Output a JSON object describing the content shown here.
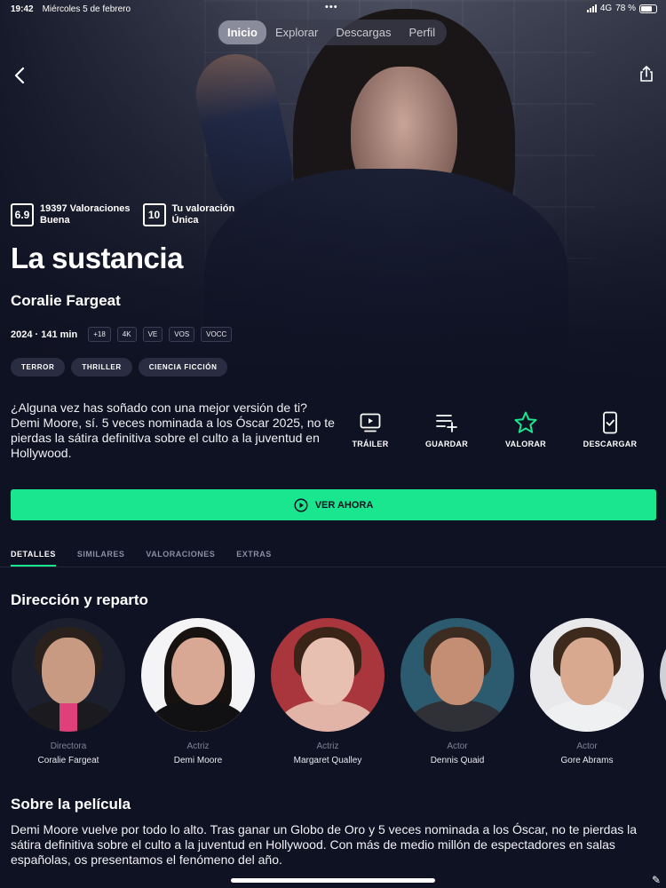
{
  "status_bar": {
    "time": "19:42",
    "date": "Miércoles 5 de febrero",
    "network": "4G",
    "battery_percent": "78 %",
    "battery_level": 0.78
  },
  "top_nav": {
    "tabs": [
      {
        "label": "Inicio",
        "active": true
      },
      {
        "label": "Explorar",
        "active": false
      },
      {
        "label": "Descargas",
        "active": false
      },
      {
        "label": "Perfil",
        "active": false
      }
    ]
  },
  "movie": {
    "title": "La sustancia",
    "director": "Coralie Fargeat",
    "year_duration": "2024 · 141 min",
    "badges": [
      "+18",
      "4K",
      "VE",
      "VOS",
      "VOCC"
    ],
    "genres": [
      "TERROR",
      "THRILLER",
      "CIENCIA FICCIÓN"
    ],
    "synopsis": "¿Alguna vez has soñado con una mejor versión de ti? Demi Moore, sí. 5 veces nominada a los Óscar 2025, no te pierdas la sátira definitiva sobre el culto a la juventud en Hollywood."
  },
  "ratings": {
    "score": "6.9",
    "count_label": "19397 Valoraciones",
    "quality": "Buena",
    "user_score": "10",
    "user_label": "Tu valoración",
    "user_quality": "Única"
  },
  "actions": {
    "trailer": "TRÁILER",
    "save": "GUARDAR",
    "rate": "VALORAR",
    "download": "DESCARGAR"
  },
  "watch_button": {
    "label": "VER AHORA"
  },
  "detail_tabs": [
    {
      "label": "DETALLES",
      "active": true
    },
    {
      "label": "SIMILARES",
      "active": false
    },
    {
      "label": "VALORACIONES",
      "active": false
    },
    {
      "label": "EXTRAS",
      "active": false
    }
  ],
  "cast_section": {
    "title": "Dirección y reparto",
    "people": [
      {
        "role": "Directora",
        "name": "Coralie Fargeat"
      },
      {
        "role": "Actriz",
        "name": "Demi Moore"
      },
      {
        "role": "Actriz",
        "name": "Margaret Qualley"
      },
      {
        "role": "Actor",
        "name": "Dennis Quaid"
      },
      {
        "role": "Actor",
        "name": "Gore Abrams"
      }
    ]
  },
  "about_section": {
    "title": "Sobre la película",
    "text": "Demi Moore vuelve por todo lo alto. Tras ganar un Globo de Oro y 5 veces nominada a los Óscar, no te pierdas la sátira definitiva sobre el culto a la juventud en Hollywood. Con más de medio millón de espectadores en salas españolas, os presentamos el fenómeno del año."
  },
  "colors": {
    "background": "#0f1222",
    "accent": "#1ae68f",
    "chip": "#2a2d42",
    "muted_text": "#8a8ea3"
  },
  "icons": {
    "back": "chevron-left-icon",
    "share": "share-icon",
    "trailer": "trailer-play-icon",
    "save": "add-to-list-icon",
    "rate": "star-outline-icon",
    "download": "download-phone-icon",
    "watch": "play-circle-icon"
  }
}
